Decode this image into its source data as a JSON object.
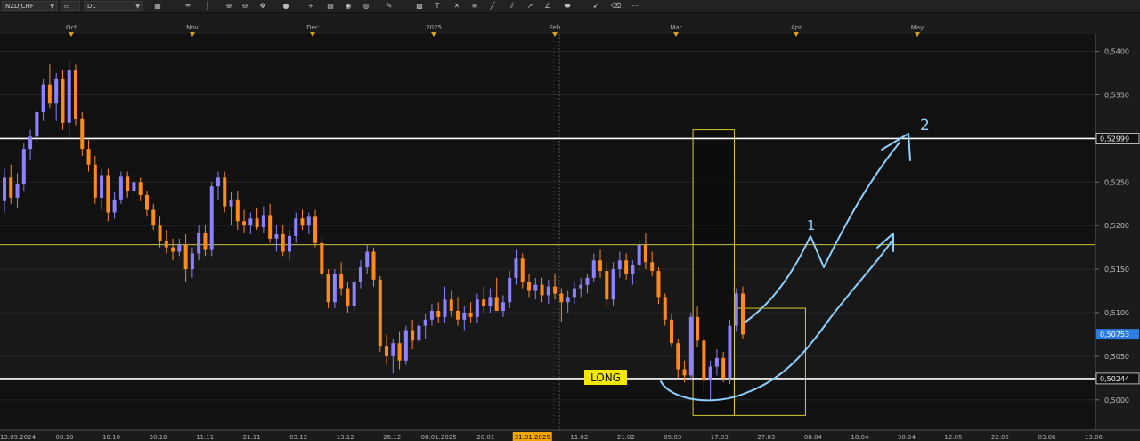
{
  "toolbar": {
    "symbol": "NZD/CHF",
    "timeframe": "D1"
  },
  "chart_data": {
    "type": "candlestick",
    "symbol": "NZD/CHF",
    "timeframe": "D1",
    "ylim": [
      0.4965,
      0.542
    ],
    "price_ticks": [
      "0,5400",
      "0,5350",
      "0,5300",
      "0,5250",
      "0,5200",
      "0,5150",
      "0,5100",
      "0,5050",
      "0,5000"
    ],
    "price_tick_values": [
      0.54,
      0.535,
      0.53,
      0.525,
      0.52,
      0.515,
      0.51,
      0.505,
      0.5
    ],
    "date_labels": [
      "13.09.2024",
      "08.10",
      "18.10",
      "30.10",
      "11.11",
      "21.11",
      "03.12",
      "13.12",
      "26.12",
      "08.01.2025",
      "20.01",
      "31.01.2025",
      "11.02",
      "21.02",
      "05.03",
      "17.03",
      "27.03",
      "08.04",
      "18.04",
      "30.04",
      "12.05",
      "22.05",
      "03.06",
      "13.06"
    ],
    "highlighted_date": "31.01.2025",
    "month_labels": [
      "Oct",
      "Nov",
      "Dec",
      "2025",
      "Feb",
      "Mar",
      "Apr",
      "May"
    ],
    "levels": [
      {
        "price": 0.52999,
        "label": "0,52999",
        "color": "#ffffff"
      },
      {
        "price": 0.5178,
        "label": "",
        "color": "#c9c23a"
      },
      {
        "price": 0.50244,
        "label": "0,50244",
        "color": "#ffffff"
      }
    ],
    "current_price": {
      "price": 0.50753,
      "label": "0,50753"
    },
    "annotations": {
      "long_label": "LONG",
      "wave_1": "1",
      "wave_2": "2"
    },
    "candles": [
      [
        0.5228,
        0.5265,
        0.5215,
        0.5255
      ],
      [
        0.5255,
        0.527,
        0.5225,
        0.5232
      ],
      [
        0.5232,
        0.526,
        0.522,
        0.5248
      ],
      [
        0.5248,
        0.5295,
        0.524,
        0.5288
      ],
      [
        0.5288,
        0.531,
        0.5275,
        0.5302
      ],
      [
        0.5302,
        0.5335,
        0.5295,
        0.533
      ],
      [
        0.533,
        0.5368,
        0.532,
        0.5362
      ],
      [
        0.5362,
        0.5385,
        0.5335,
        0.534
      ],
      [
        0.534,
        0.5375,
        0.532,
        0.5368
      ],
      [
        0.5368,
        0.5378,
        0.531,
        0.5318
      ],
      [
        0.5318,
        0.539,
        0.53,
        0.5378
      ],
      [
        0.5378,
        0.5385,
        0.5315,
        0.5322
      ],
      [
        0.5322,
        0.533,
        0.528,
        0.5288
      ],
      [
        0.5288,
        0.5298,
        0.5262,
        0.527
      ],
      [
        0.527,
        0.528,
        0.5225,
        0.5232
      ],
      [
        0.5232,
        0.5265,
        0.5218,
        0.5258
      ],
      [
        0.5258,
        0.5265,
        0.5205,
        0.5215
      ],
      [
        0.5215,
        0.5238,
        0.5208,
        0.523
      ],
      [
        0.523,
        0.5262,
        0.5225,
        0.5256
      ],
      [
        0.5256,
        0.5262,
        0.5232,
        0.524
      ],
      [
        0.524,
        0.5262,
        0.523,
        0.525
      ],
      [
        0.525,
        0.5255,
        0.5228,
        0.5235
      ],
      [
        0.5235,
        0.524,
        0.521,
        0.5218
      ],
      [
        0.5218,
        0.5225,
        0.5195,
        0.52
      ],
      [
        0.52,
        0.521,
        0.5175,
        0.5182
      ],
      [
        0.5182,
        0.5195,
        0.5168,
        0.5175
      ],
      [
        0.5175,
        0.5185,
        0.516,
        0.517
      ],
      [
        0.517,
        0.5185,
        0.5165,
        0.5178
      ],
      [
        0.5178,
        0.519,
        0.5135,
        0.515
      ],
      [
        0.515,
        0.5175,
        0.514,
        0.5168
      ],
      [
        0.5168,
        0.52,
        0.516,
        0.5192
      ],
      [
        0.5192,
        0.52,
        0.5165,
        0.5172
      ],
      [
        0.5172,
        0.525,
        0.5165,
        0.5245
      ],
      [
        0.5245,
        0.5262,
        0.523,
        0.5255
      ],
      [
        0.5255,
        0.5262,
        0.5215,
        0.5222
      ],
      [
        0.5222,
        0.5238,
        0.52,
        0.523
      ],
      [
        0.523,
        0.524,
        0.5195,
        0.5205
      ],
      [
        0.5205,
        0.5218,
        0.5192,
        0.52
      ],
      [
        0.52,
        0.5215,
        0.519,
        0.5208
      ],
      [
        0.5208,
        0.522,
        0.5195,
        0.5198
      ],
      [
        0.5198,
        0.5222,
        0.5192,
        0.5212
      ],
      [
        0.5212,
        0.5225,
        0.518,
        0.5185
      ],
      [
        0.5185,
        0.52,
        0.517,
        0.519
      ],
      [
        0.519,
        0.52,
        0.5165,
        0.517
      ],
      [
        0.517,
        0.5195,
        0.516,
        0.5188
      ],
      [
        0.5188,
        0.5215,
        0.518,
        0.5208
      ],
      [
        0.5208,
        0.5218,
        0.5195,
        0.52
      ],
      [
        0.52,
        0.5215,
        0.519,
        0.521
      ],
      [
        0.521,
        0.5218,
        0.5175,
        0.518
      ],
      [
        0.518,
        0.5188,
        0.514,
        0.5145
      ],
      [
        0.5145,
        0.515,
        0.5105,
        0.5112
      ],
      [
        0.5112,
        0.515,
        0.5105,
        0.5145
      ],
      [
        0.5145,
        0.5158,
        0.512,
        0.5128
      ],
      [
        0.5128,
        0.5135,
        0.51,
        0.5108
      ],
      [
        0.5108,
        0.514,
        0.5102,
        0.5135
      ],
      [
        0.5135,
        0.516,
        0.5128,
        0.5152
      ],
      [
        0.5152,
        0.5178,
        0.5145,
        0.517
      ],
      [
        0.517,
        0.5175,
        0.513,
        0.5138
      ],
      [
        0.5138,
        0.5142,
        0.5055,
        0.5062
      ],
      [
        0.5062,
        0.5075,
        0.504,
        0.505
      ],
      [
        0.505,
        0.507,
        0.503,
        0.5065
      ],
      [
        0.5065,
        0.5078,
        0.5035,
        0.5045
      ],
      [
        0.5045,
        0.5085,
        0.504,
        0.508
      ],
      [
        0.508,
        0.5092,
        0.5058,
        0.5068
      ],
      [
        0.5068,
        0.509,
        0.506,
        0.5085
      ],
      [
        0.5085,
        0.5098,
        0.507,
        0.5092
      ],
      [
        0.5092,
        0.511,
        0.5085,
        0.5102
      ],
      [
        0.5102,
        0.5112,
        0.5088,
        0.5095
      ],
      [
        0.5095,
        0.513,
        0.5088,
        0.5115
      ],
      [
        0.5115,
        0.5125,
        0.5095,
        0.5102
      ],
      [
        0.5102,
        0.5118,
        0.5085,
        0.5092
      ],
      [
        0.5092,
        0.5108,
        0.508,
        0.51
      ],
      [
        0.51,
        0.5112,
        0.5088,
        0.5095
      ],
      [
        0.5095,
        0.5122,
        0.5088,
        0.5115
      ],
      [
        0.5115,
        0.513,
        0.51,
        0.5108
      ],
      [
        0.5108,
        0.5128,
        0.51,
        0.5118
      ],
      [
        0.5118,
        0.514,
        0.511,
        0.5102
      ],
      [
        0.5102,
        0.512,
        0.5095,
        0.5112
      ],
      [
        0.5112,
        0.5148,
        0.5105,
        0.514
      ],
      [
        0.514,
        0.5172,
        0.5132,
        0.5162
      ],
      [
        0.5162,
        0.5168,
        0.5128,
        0.5135
      ],
      [
        0.5135,
        0.5145,
        0.5118,
        0.5125
      ],
      [
        0.5125,
        0.514,
        0.5115,
        0.5132
      ],
      [
        0.5132,
        0.514,
        0.5112,
        0.512
      ],
      [
        0.512,
        0.5138,
        0.511,
        0.513
      ],
      [
        0.513,
        0.5145,
        0.5115,
        0.5122
      ],
      [
        0.5122,
        0.5128,
        0.509,
        0.5112
      ],
      [
        0.5112,
        0.5125,
        0.51,
        0.5118
      ],
      [
        0.5118,
        0.5135,
        0.511,
        0.5128
      ],
      [
        0.5128,
        0.514,
        0.5118,
        0.5132
      ],
      [
        0.5132,
        0.5145,
        0.5122,
        0.514
      ],
      [
        0.514,
        0.5168,
        0.5135,
        0.516
      ],
      [
        0.516,
        0.5172,
        0.514,
        0.5148
      ],
      [
        0.5148,
        0.5158,
        0.5108,
        0.5115
      ],
      [
        0.5115,
        0.5158,
        0.5108,
        0.515
      ],
      [
        0.515,
        0.517,
        0.514,
        0.516
      ],
      [
        0.516,
        0.5168,
        0.5138,
        0.5145
      ],
      [
        0.5145,
        0.516,
        0.5132,
        0.5155
      ],
      [
        0.5155,
        0.5185,
        0.5148,
        0.5178
      ],
      [
        0.5178,
        0.5192,
        0.515,
        0.5158
      ],
      [
        0.5158,
        0.517,
        0.5142,
        0.5148
      ],
      [
        0.5148,
        0.5152,
        0.511,
        0.5118
      ],
      [
        0.5118,
        0.5122,
        0.5085,
        0.5092
      ],
      [
        0.5092,
        0.5098,
        0.506,
        0.5065
      ],
      [
        0.5065,
        0.507,
        0.5025,
        0.5035
      ],
      [
        0.5035,
        0.5045,
        0.502,
        0.5028
      ],
      [
        0.5028,
        0.51,
        0.5022,
        0.5095
      ],
      [
        0.5095,
        0.5108,
        0.506,
        0.5068
      ],
      [
        0.5068,
        0.5075,
        0.501,
        0.5022
      ],
      [
        0.5022,
        0.5045,
        0.5,
        0.5038
      ],
      [
        0.5038,
        0.5058,
        0.5028,
        0.5048
      ],
      [
        0.5048,
        0.5055,
        0.502,
        0.5025
      ],
      [
        0.5025,
        0.5092,
        0.5018,
        0.5085
      ],
      [
        0.5085,
        0.5128,
        0.5078,
        0.5122
      ],
      [
        0.5122,
        0.513,
        0.507,
        0.5075
      ]
    ]
  }
}
